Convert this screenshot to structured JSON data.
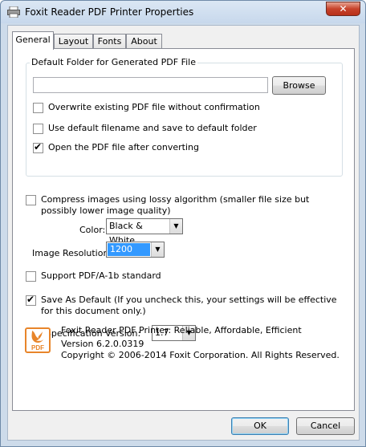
{
  "window": {
    "title": "Foxit Reader PDF Printer Properties",
    "close_glyph": "✕"
  },
  "tabs": [
    {
      "label": "General",
      "active": true
    },
    {
      "label": "Layout",
      "active": false
    },
    {
      "label": "Fonts",
      "active": false
    },
    {
      "label": "About",
      "active": false
    }
  ],
  "default_folder": {
    "legend": "Default Folder for Generated PDF File",
    "path_value": "",
    "browse_label": "Browse",
    "overwrite_label": "Overwrite existing PDF file without confirmation",
    "overwrite_checked": false,
    "use_default_label": "Use default filename and save to default folder",
    "use_default_checked": false,
    "open_after_label": "Open the PDF file after converting",
    "open_after_checked": true
  },
  "compress": {
    "label": "Compress images using lossy algorithm (smaller file size but possibly lower image quality)",
    "checked": false,
    "color_label": "Color:",
    "color_value": "Black & White",
    "resolution_label": "Image Resolution:",
    "resolution_value": "1200"
  },
  "pdfa": {
    "label": "Support PDF/A-1b standard",
    "checked": false
  },
  "save_default": {
    "label": "Save As Default (If you uncheck this, your settings will be effective for this document only.)",
    "checked": true
  },
  "spec": {
    "label": "PDF Specification Version:",
    "value": "1.7"
  },
  "about": {
    "line1": "Foxit Reader PDF Printer: Reliable, Affordable, Efficient",
    "line2": "Version 6.2.0.0319",
    "line3": "Copyright © 2006-2014 Foxit Corporation. All Rights Reserved.",
    "logo_text": "PDF",
    "logo_color": "#e8852a"
  },
  "footer": {
    "ok_label": "OK",
    "cancel_label": "Cancel"
  }
}
